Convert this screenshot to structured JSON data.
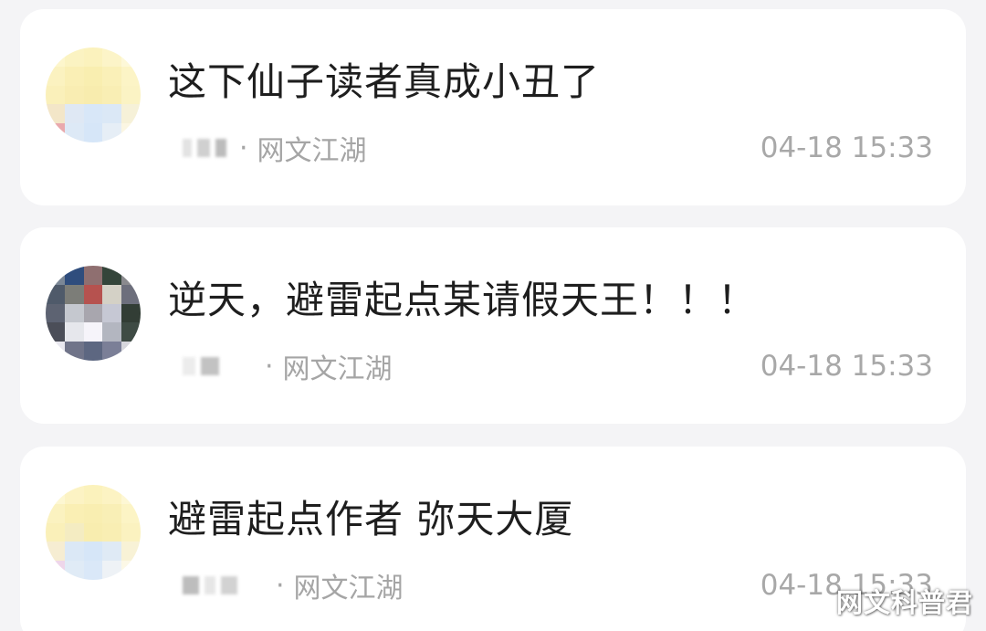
{
  "posts": [
    {
      "text": "这下仙子读者真成小丑了",
      "separator": "·",
      "source": "网文江湖",
      "time": "04-18 15:33"
    },
    {
      "text": "逆天，避雷起点某请假天王！！！",
      "separator": "·",
      "source": "网文江湖",
      "time": "04-18 15:33"
    },
    {
      "text": "避雷起点作者 弥天大厦",
      "separator": "·",
      "source": "网文江湖",
      "time": "04-18 15:33"
    }
  ],
  "watermark": "网文科普君",
  "colors": {
    "background": "#f4f4f6",
    "card": "#ffffff",
    "text": "#1e1e1e",
    "meta": "#a5a5a5"
  }
}
